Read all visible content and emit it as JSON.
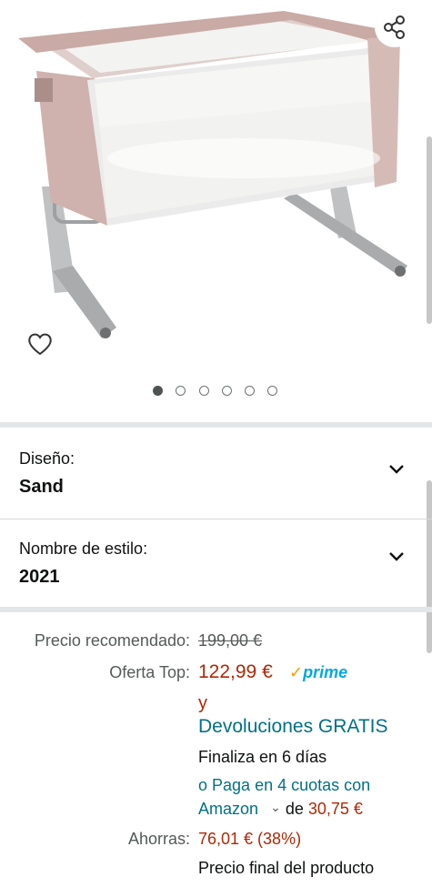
{
  "gallery": {
    "image_alt": "",
    "dots_total": 6,
    "active_dot": 0
  },
  "variations": [
    {
      "label": "Diseño:",
      "value": "Sand"
    },
    {
      "label": "Nombre de estilo:",
      "value": "2021"
    }
  ],
  "pricing": {
    "list_label": "Precio recomendado:",
    "list_price": "199,00 €",
    "deal_label": "Oferta Top:",
    "deal_price": "122,99 €",
    "prime_check": "✓",
    "prime_word": "prime",
    "y_text": "y",
    "returns_text": "Devoluciones GRATIS",
    "ends_text": "Finaliza en 6 días",
    "installments_prefix": "o",
    "installments_link_1": "Paga en 4 cuotas con",
    "installments_link_2": "Amazon",
    "installments_chevron": "⌄",
    "installments_de": "de",
    "installments_amount": "30,75 €",
    "savings_label": "Ahorras:",
    "savings_value": "76,01 € (38%)",
    "final_price_text": "Precio final del producto"
  },
  "colors": {
    "price_red": "#b12704",
    "link_teal": "#007185",
    "prime_blue": "#00a8e1",
    "prime_orange": "#ff9900"
  },
  "icons": [
    "share-icon",
    "heart-icon",
    "chevron-down-icon"
  ]
}
